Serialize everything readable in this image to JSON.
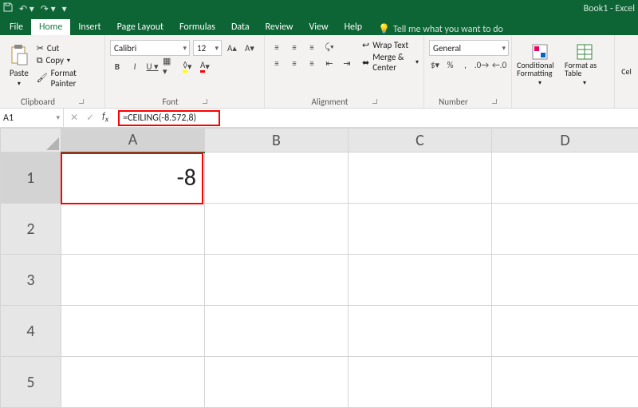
{
  "title": "Book1 - Excel",
  "tabs": {
    "file": "File",
    "home": "Home",
    "insert": "Insert",
    "pagelayout": "Page Layout",
    "formulas": "Formulas",
    "data": "Data",
    "review": "Review",
    "view": "View",
    "help": "Help",
    "tellme": "Tell me what you want to do"
  },
  "ribbon": {
    "paste": "Paste",
    "cut": "Cut",
    "copy": "Copy",
    "formatPainter": "Format Painter",
    "groupClipboard": "Clipboard",
    "font": "Calibri",
    "size": "12",
    "groupFont": "Font",
    "wrap": "Wrap Text",
    "merge": "Merge & Center",
    "groupAlign": "Alignment",
    "numfmt": "General",
    "groupNumber": "Number",
    "conditional": "Conditional Formatting",
    "formatAs": "Format as Table",
    "cell": "Cel"
  },
  "namebox": "A1",
  "formula": "=CEILING(-8.572,8)",
  "cols": [
    "A",
    "B",
    "C",
    "D"
  ],
  "rows": [
    "1",
    "2",
    "3",
    "4",
    "5"
  ],
  "cellA1": "-8"
}
